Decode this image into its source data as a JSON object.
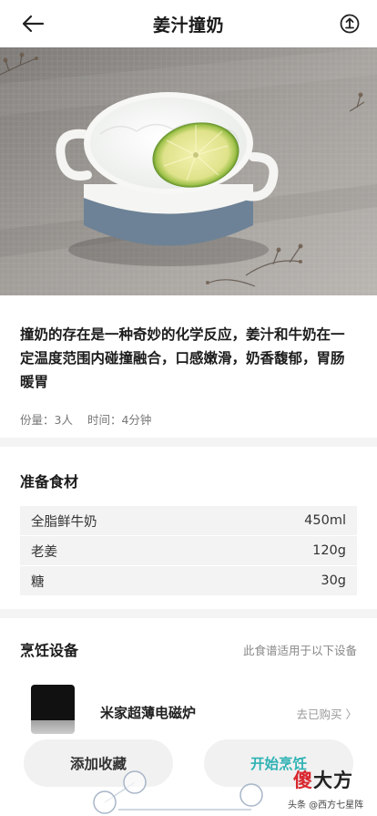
{
  "header": {
    "title": "姜汁撞奶",
    "back_icon": "arrow-left-icon",
    "share_icon": "share-icon"
  },
  "recipe": {
    "description": "撞奶的存在是一种奇妙的化学反应，姜汁和牛奶在一定温度范围内碰撞融合，口感嫩滑，奶香馥郁，胃肠暖胃",
    "servings": "份量：3人",
    "time": "时间：4分钟"
  },
  "ingredients_section": {
    "title": "准备食材",
    "items": [
      {
        "name": "全脂鲜牛奶",
        "amount": "450ml"
      },
      {
        "name": "老姜",
        "amount": "120g"
      },
      {
        "name": "糖",
        "amount": "30g"
      }
    ]
  },
  "device_section": {
    "title": "烹饪设备",
    "note": "此食谱适用于以下设备",
    "device_name": "米家超薄电磁炉",
    "device_hint": "去已购买 〉"
  },
  "actions": {
    "favorite_label": "添加收藏",
    "start_label": "开始烹饪"
  },
  "watermark": {
    "brand_red": "傻",
    "brand_black": "大方",
    "caption": "头条 @西方七星阵"
  },
  "colors": {
    "accent": "#2fb2b4",
    "brand_red": "#d8262e"
  }
}
